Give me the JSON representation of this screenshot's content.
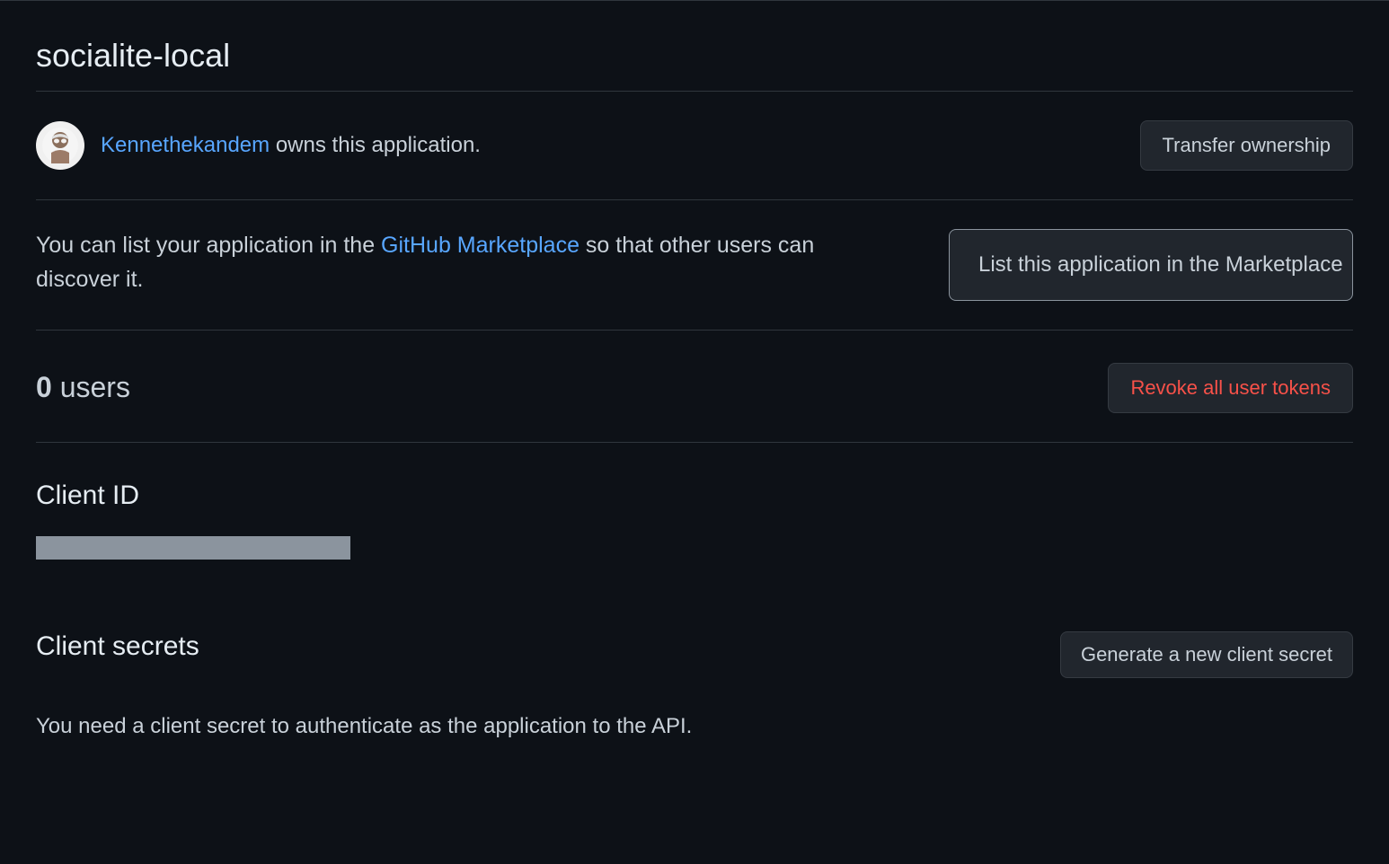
{
  "page": {
    "title": "socialite-local"
  },
  "owner": {
    "name": "Kennethekandem",
    "owns_text": " owns this application.",
    "transfer_button": "Transfer ownership"
  },
  "marketplace": {
    "text_prefix": "You can list your application in the ",
    "link_text": "GitHub Marketplace",
    "text_suffix": " so that other users can discover it.",
    "list_button": "List this application in the Marketplace"
  },
  "users": {
    "count": "0",
    "label": " users",
    "revoke_button": "Revoke all user tokens"
  },
  "client_id": {
    "heading": "Client ID"
  },
  "client_secrets": {
    "heading": "Client secrets",
    "generate_button": "Generate a new client secret",
    "helper_text": "You need a client secret to authenticate as the application to the API."
  }
}
